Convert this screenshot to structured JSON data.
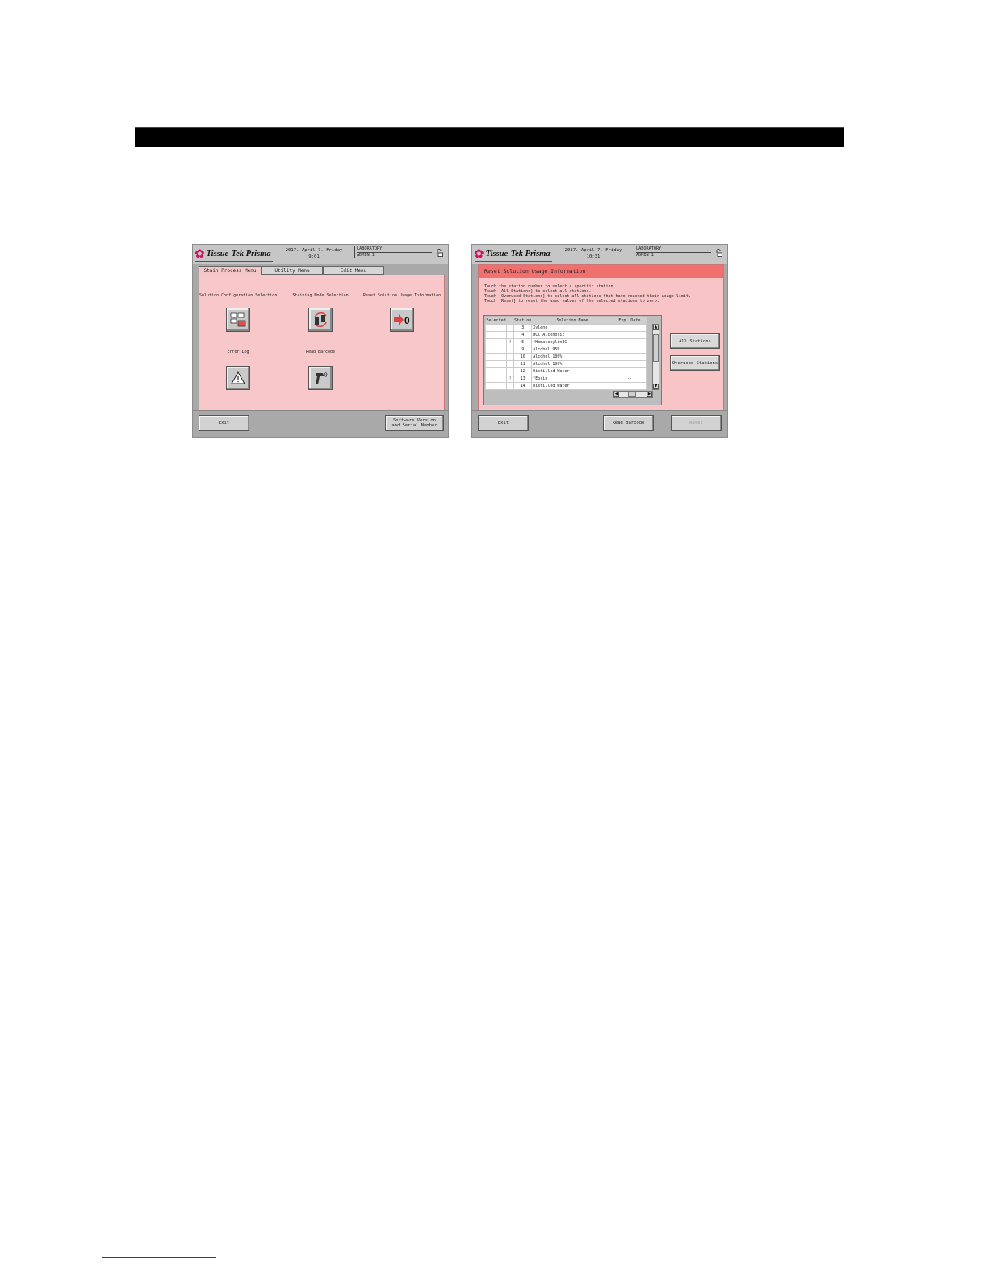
{
  "screen1": {
    "brand": "Tissue-Tek Prisma",
    "date_line1": "2017. April 7. Friday",
    "date_line2": "9:01",
    "lab_line1": "LABORATORY",
    "lab_line2": "ADMIN 1",
    "tabs": [
      "Stain Process Menu",
      "Utility Menu",
      "Edit Menu"
    ],
    "active_tab": "Stain Process Menu",
    "items": [
      {
        "label": "Solution Configuration Selection",
        "icon": "solution-config-icon"
      },
      {
        "label": "Staining Mode Selection",
        "icon": "staining-mode-icon"
      },
      {
        "label": "Reset Solution Usage Information",
        "icon": "reset-usage-icon"
      },
      {
        "label": "Error Log",
        "icon": "warning-icon"
      },
      {
        "label": "Read Barcode",
        "icon": "barcode-scanner-icon"
      }
    ],
    "exit_label": "Exit",
    "version_label": "Software Version\nand Serial Number"
  },
  "screen2": {
    "brand": "Tissue-Tek Prisma",
    "date_line1": "2017. April 7. Friday",
    "date_line2": "10:31",
    "lab_line1": "LABORATORY",
    "lab_line2": "ADMIN 1",
    "panel_title": "Reset Solution Usage Information",
    "instructions": [
      "Touch the station number to select a specific station.",
      "Touch [All Stations] to select all stations.",
      "Touch [Overused Stations] to select all stations that have reached their usage limit.",
      "Touch [Reset] to reset the used values of the selected stations to zero."
    ],
    "columns": [
      "Selected",
      "Station",
      "Solution Name",
      "Exp. Date"
    ],
    "rows": [
      {
        "selected": "",
        "mark": "",
        "station": "3",
        "name": "Xylene",
        "exp": ""
      },
      {
        "selected": "",
        "mark": "",
        "station": "4",
        "name": "HCl Alcoholic",
        "exp": ""
      },
      {
        "selected": "",
        "mark": "!",
        "station": "5",
        "name": "*Hematoxylin3G",
        "exp": "--"
      },
      {
        "selected": "",
        "mark": "",
        "station": "9",
        "name": "Alcohol 95%",
        "exp": ""
      },
      {
        "selected": "",
        "mark": "",
        "station": "10",
        "name": "Alcohol 100%",
        "exp": ""
      },
      {
        "selected": "",
        "mark": "",
        "station": "11",
        "name": "Alcohol 100%",
        "exp": ""
      },
      {
        "selected": "",
        "mark": "",
        "station": "12",
        "name": "Distilled Water",
        "exp": ""
      },
      {
        "selected": "",
        "mark": "!",
        "station": "13",
        "name": "*Eosin",
        "exp": "--"
      },
      {
        "selected": "",
        "mark": "",
        "station": "14",
        "name": "Distilled Water",
        "exp": ""
      }
    ],
    "all_stations_label": "All Stations",
    "overused_label": "Overused Stations",
    "exit_label": "Exit",
    "read_barcode_label": "Read Barcode",
    "reset_label": "Reset"
  }
}
